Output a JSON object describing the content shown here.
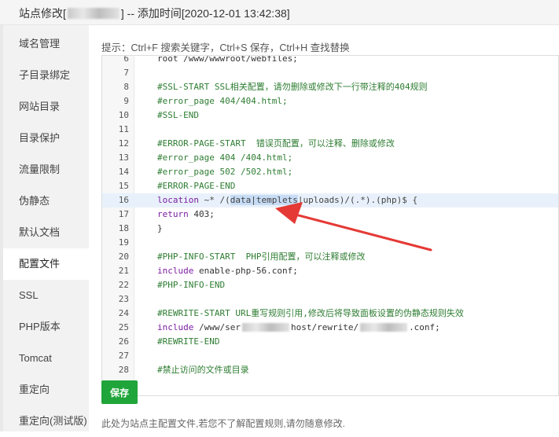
{
  "window": {
    "title_prefix": "站点修改[",
    "title_suffix": "] -- 添加时间[2020-12-01 13:42:38]"
  },
  "sidebar": {
    "items": [
      {
        "label": "域名管理"
      },
      {
        "label": "子目录绑定"
      },
      {
        "label": "网站目录"
      },
      {
        "label": "目录保护"
      },
      {
        "label": "流量限制"
      },
      {
        "label": "伪静态"
      },
      {
        "label": "默认文档"
      },
      {
        "label": "配置文件",
        "active": true
      },
      {
        "label": "SSL"
      },
      {
        "label": "PHP版本"
      },
      {
        "label": "Tomcat"
      },
      {
        "label": "重定向"
      },
      {
        "label": "重定向(测试版)"
      }
    ]
  },
  "main": {
    "tip": "提示：Ctrl+F 搜索关键字，Ctrl+S 保存，Ctrl+H 查找替换",
    "save_label": "保存",
    "note": "此处为站点主配置文件,若您不了解配置规则,请勿随意修改."
  },
  "editor": {
    "lines": [
      {
        "n": "6",
        "segs": [
          {
            "t": "root /www/wwwroot/webfiles;",
            "c": "c-plain"
          }
        ]
      },
      {
        "n": "7",
        "segs": [
          {
            "t": "",
            "c": "c-plain"
          }
        ]
      },
      {
        "n": "8",
        "segs": [
          {
            "t": "#SSL-START SSL相关配置，请勿删除或修改下一行带注释的404规则",
            "c": "c-com"
          }
        ]
      },
      {
        "n": "9",
        "segs": [
          {
            "t": "#error_page 404/404.html;",
            "c": "c-com"
          }
        ]
      },
      {
        "n": "10",
        "segs": [
          {
            "t": "#SSL-END",
            "c": "c-com"
          }
        ]
      },
      {
        "n": "11",
        "segs": [
          {
            "t": "",
            "c": "c-plain"
          }
        ]
      },
      {
        "n": "12",
        "segs": [
          {
            "t": "#ERROR-PAGE-START  错误页配置，可以注释、删除或修改",
            "c": "c-com"
          }
        ]
      },
      {
        "n": "13",
        "segs": [
          {
            "t": "#error_page 404 /404.html;",
            "c": "c-com"
          }
        ]
      },
      {
        "n": "14",
        "segs": [
          {
            "t": "#error_page 502 /502.html;",
            "c": "c-com"
          }
        ]
      },
      {
        "n": "15",
        "segs": [
          {
            "t": "#ERROR-PAGE-END",
            "c": "c-com"
          }
        ]
      },
      {
        "n": "16",
        "active": true,
        "segs": [
          {
            "t": "location",
            "c": "c-kw"
          },
          {
            "t": " ~* /(",
            "c": "c-str"
          },
          {
            "t": "data|templets",
            "c": "c-str hl"
          },
          {
            "t": "|uploads)/(.*).(php)$ {",
            "c": "c-str"
          }
        ]
      },
      {
        "n": "17",
        "segs": [
          {
            "t": "return",
            "c": "c-kw"
          },
          {
            "t": " 403;",
            "c": "c-plain"
          }
        ]
      },
      {
        "n": "18",
        "segs": [
          {
            "t": "}",
            "c": "c-plain"
          }
        ]
      },
      {
        "n": "19",
        "segs": [
          {
            "t": "",
            "c": "c-plain"
          }
        ]
      },
      {
        "n": "20",
        "segs": [
          {
            "t": "#PHP-INFO-START  PHP引用配置，可以注释或修改",
            "c": "c-com"
          }
        ]
      },
      {
        "n": "21",
        "segs": [
          {
            "t": "include",
            "c": "c-kw"
          },
          {
            "t": " enable-php-56.conf;",
            "c": "c-plain"
          }
        ]
      },
      {
        "n": "22",
        "segs": [
          {
            "t": "#PHP-INFO-END",
            "c": "c-com"
          }
        ]
      },
      {
        "n": "23",
        "segs": [
          {
            "t": "",
            "c": "c-plain"
          }
        ]
      },
      {
        "n": "24",
        "segs": [
          {
            "t": "#REWRITE-START URL重写规则引用,修改后将导致面板设置的伪静态规则失效",
            "c": "c-com"
          }
        ]
      },
      {
        "n": "25",
        "segs": [
          {
            "t": "include",
            "c": "c-kw"
          },
          {
            "t": " /www/ser",
            "c": "c-plain"
          },
          {
            "t": "",
            "c": "blur"
          },
          {
            "t": "host/rewrite/",
            "c": "c-plain"
          },
          {
            "t": "",
            "c": "blur"
          },
          {
            "t": ".conf;",
            "c": "c-plain"
          }
        ]
      },
      {
        "n": "26",
        "segs": [
          {
            "t": "#REWRITE-END",
            "c": "c-com"
          }
        ]
      },
      {
        "n": "27",
        "segs": [
          {
            "t": "",
            "c": "c-plain"
          }
        ]
      },
      {
        "n": "28",
        "segs": [
          {
            "t": "#禁止访问的文件或目录",
            "c": "c-com"
          }
        ]
      }
    ]
  },
  "colors": {
    "accent_green": "#20a53a",
    "arrow_red": "#e53935",
    "comment_green": "#2e7d32",
    "keyword_purple": "#7b1fa2"
  },
  "icons": {
    "arrow": "red-annotation-arrow"
  }
}
